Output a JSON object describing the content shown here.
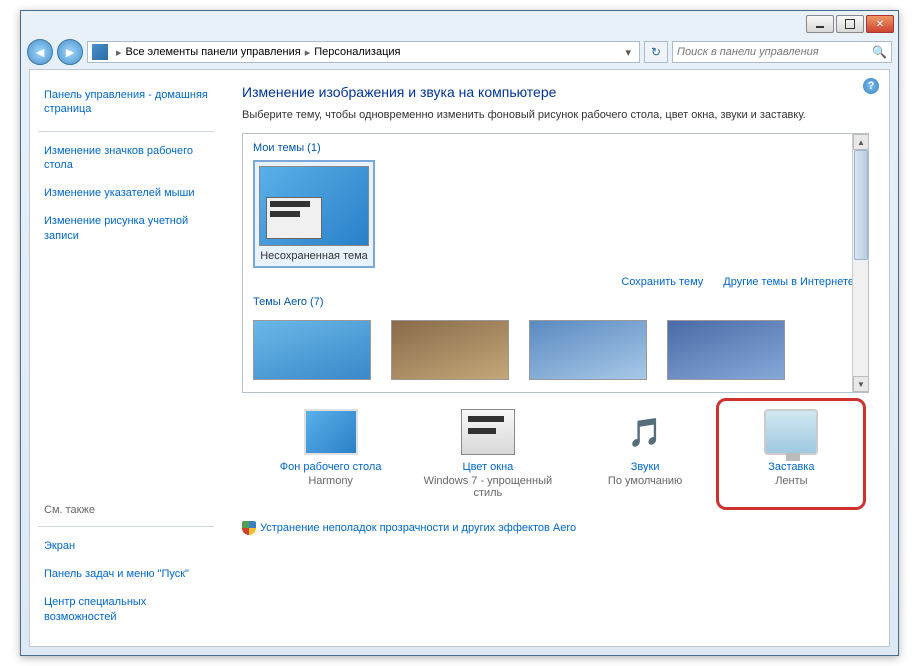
{
  "address": {
    "crumb1": "Все элементы панели управления",
    "crumb2": "Персонализация"
  },
  "search": {
    "placeholder": "Поиск в панели управления"
  },
  "sidebar": {
    "home": "Панель управления - домашняя страница",
    "links": [
      "Изменение значков рабочего стола",
      "Изменение указателей мыши",
      "Изменение рисунка учетной записи"
    ],
    "see_also_label": "См. также",
    "see_also": [
      "Экран",
      "Панель задач и меню \"Пуск\"",
      "Центр специальных возможностей"
    ]
  },
  "main": {
    "heading": "Изменение изображения и звука на компьютере",
    "subtext": "Выберите тему, чтобы одновременно изменить фоновый рисунок рабочего стола, цвет окна, звуки и заставку.",
    "my_themes_label": "Мои темы (1)",
    "unsaved_theme": "Несохраненная тема",
    "save_theme": "Сохранить тему",
    "online_themes": "Другие темы в Интернете",
    "aero_label": "Темы Aero (7)",
    "aero_fix": "Устранение неполадок прозрачности и других эффектов Aero"
  },
  "settings": {
    "bg": {
      "title": "Фон рабочего стола",
      "value": "Harmony"
    },
    "color": {
      "title": "Цвет окна",
      "value": "Windows 7 - упрощенный стиль"
    },
    "sounds": {
      "title": "Звуки",
      "value": "По умолчанию"
    },
    "saver": {
      "title": "Заставка",
      "value": "Ленты"
    }
  }
}
